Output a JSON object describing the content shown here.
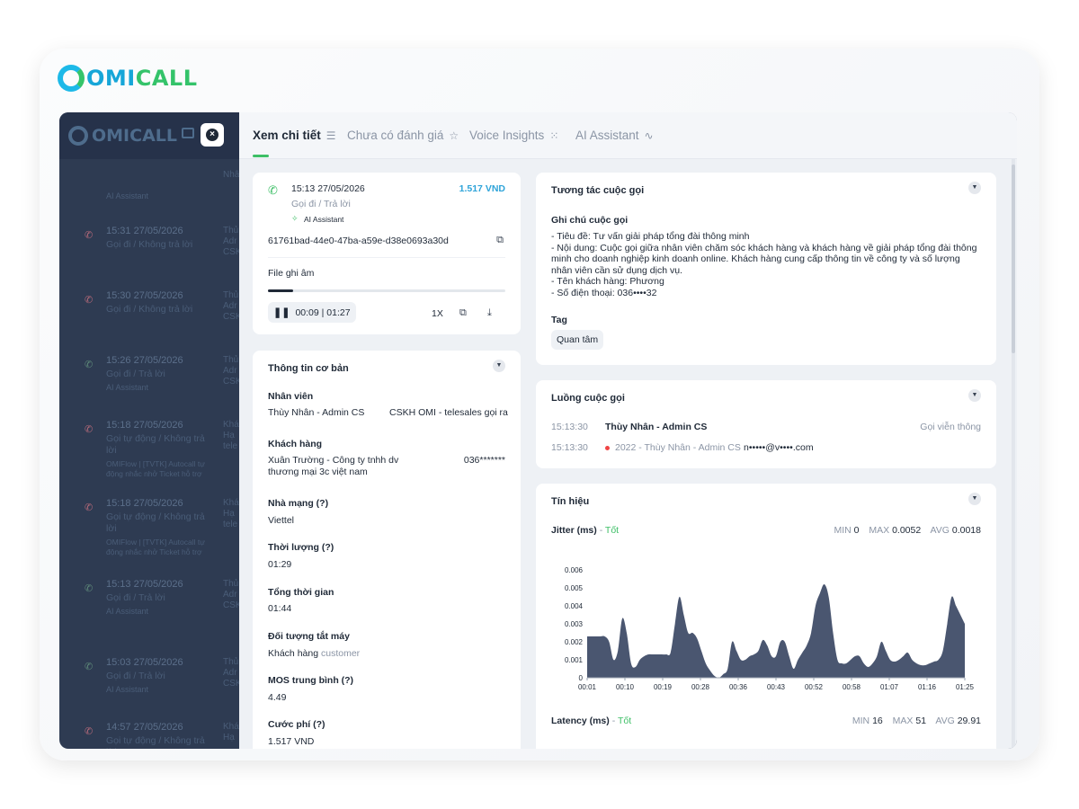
{
  "brand": {
    "part1": "OMI",
    "part2": "CALL"
  },
  "background": {
    "logo": "OMICALL",
    "close_icon": "close-icon",
    "rows": [
      {
        "time": "",
        "status": "",
        "ai": "AI Assistant",
        "col2": "Nhâ"
      },
      {
        "time": "15:31 27/05/2026",
        "status": "Gọi đi / Không trả lời",
        "ai": "",
        "col2": "Thủ\nAdr\nCSK"
      },
      {
        "time": "15:30 27/05/2026",
        "status": "Gọi đi / Không trả lời",
        "ai": "",
        "col2": "Thủ\nAdr\nCSK"
      },
      {
        "time": "15:26 27/05/2026",
        "status": "Gọi đi / Trả lời",
        "ai": "AI Assistant",
        "col2": "Thủ\nAdr\nCSK"
      },
      {
        "time": "15:18 27/05/2026",
        "status": "Gọi tự động / Không trả lời",
        "flow": "OMIFlow | [TVTK] Autocall tự động nhắc nhở Ticket hỗ trợ",
        "col2": "Khá\nHạ\ntele"
      },
      {
        "time": "15:18 27/05/2026",
        "status": "Gọi tự động / Không trả lời",
        "flow": "OMIFlow | [TVTK] Autocall tự động nhắc nhở Ticket hỗ trợ",
        "col2": "Khá\nHạ\ntele"
      },
      {
        "time": "15:13 27/05/2026",
        "status": "Gọi đi / Trả lời",
        "ai": "AI Assistant",
        "col2": "Thủ\nAdr\nCSK"
      },
      {
        "time": "15:03 27/05/2026",
        "status": "Gọi đi / Trả lời",
        "ai": "AI Assistant",
        "col2": "Thủ\nAdr\nCSK"
      },
      {
        "time": "14:57 27/05/2026",
        "status": "Gọi tự động / Không trả lời",
        "ai": "",
        "col2": "Khá\nHạ"
      }
    ]
  },
  "tabs": [
    {
      "label": "Xem chi tiết",
      "icon": "document-icon",
      "active": true
    },
    {
      "label": "Chưa có đánh giá",
      "icon": "star-icon",
      "active": false
    },
    {
      "label": "Voice Insights",
      "icon": "grid-icon",
      "active": false
    },
    {
      "label": "AI Assistant",
      "icon": "waveform-icon",
      "active": false
    }
  ],
  "call": {
    "datetime": "15:13 27/05/2026",
    "direction": "Gọi đi / Trả lời",
    "ai_badge": "AI Assistant",
    "price": "1.517 VND",
    "call_id": "61761bad-44e0-47ba-a59e-d38e0693a30d",
    "recording_label": "File ghi âm",
    "progress_fraction": 0.107,
    "playback_time": "00:09 | 01:27",
    "speed": "1X"
  },
  "basic_info": {
    "title": "Thông tin cơ bản",
    "staff_label": "Nhân viên",
    "staff_name": "Thùy Nhân - Admin CS",
    "staff_group": "CSKH OMI - telesales gọi ra",
    "customer_label": "Khách hàng",
    "customer_name": "Xuân Trường - Công ty tnhh dv thương mại 3c việt nam",
    "customer_phone": "036*******",
    "carrier_label": "Nhà mạng (?)",
    "carrier": "Viettel",
    "duration_label": "Thời lượng (?)",
    "duration": "01:29",
    "total_label": "Tổng thời gian",
    "total": "01:44",
    "hangup_label": "Đối tượng tắt máy",
    "hangup_value": "Khách hàng",
    "hangup_sub": "customer",
    "mos_label": "MOS trung bình (?)",
    "mos": "4.49",
    "fee_label": "Cước phí (?)",
    "fee": "1.517 VND"
  },
  "interaction": {
    "title": "Tương tác cuộc gọi",
    "notes_label": "Ghi chú cuộc gọi",
    "notes": [
      "- Tiêu đề: Tư vấn giải pháp tổng đài thông minh",
      "- Nội dung: Cuộc gọi giữa nhân viên chăm sóc khách hàng và khách hàng về giải pháp tổng đài thông",
      "minh cho doanh nghiệp kinh doanh online. Khách hàng cung cấp thông tin về công ty và số lượng",
      "nhân viên cần sử dụng dịch vụ.",
      "- Tên khách hàng: Phương",
      "- Số điện thoại: 036••••32"
    ],
    "tag_label": "Tag",
    "tag": "Quan tâm"
  },
  "flow": {
    "title": "Luồng cuộc gọi",
    "rows": [
      {
        "time": "15:13:30",
        "agent": "Thùy Nhân - Admin CS",
        "channel": "Gọi viễn thông"
      },
      {
        "time": "15:13:30",
        "detail": "2022 - Thùy Nhân - Admin CS",
        "email": "n•••••@v••••.com"
      }
    ]
  },
  "signal": {
    "title": "Tín hiệu",
    "jitter_label": "Jitter (ms)",
    "jitter_quality": "Tốt",
    "jitter_min_label": "MIN",
    "jitter_min": "0",
    "jitter_max_label": "MAX",
    "jitter_max": "0.0052",
    "jitter_avg_label": "AVG",
    "jitter_avg": "0.0018",
    "latency_label": "Latency (ms)",
    "latency_quality": "Tốt",
    "latency_min_label": "MIN",
    "latency_min": "16",
    "latency_max_label": "MAX",
    "latency_max": "51",
    "latency_avg_label": "AVG",
    "latency_avg": "29.91"
  },
  "chart_data": {
    "type": "area",
    "title": "",
    "xlabel": "",
    "ylabel": "",
    "ylim": [
      0,
      0.006
    ],
    "yticks": [
      "0",
      "0.001",
      "0.002",
      "0.003",
      "0.004",
      "0.005",
      "0.006"
    ],
    "xticks": [
      "00:01",
      "00:10",
      "00:19",
      "00:28",
      "00:36",
      "00:43",
      "00:52",
      "00:58",
      "01:07",
      "01:16",
      "01:25"
    ],
    "x": [
      0,
      1,
      2,
      3,
      4,
      5,
      6,
      7,
      8,
      9,
      10,
      11,
      12,
      13,
      14,
      15,
      16,
      17,
      18,
      19,
      20,
      21,
      22,
      23,
      24,
      25,
      26,
      27,
      28,
      29,
      30,
      31,
      32,
      33,
      34,
      35,
      36,
      37,
      38,
      39,
      40,
      41,
      42,
      43,
      44,
      45,
      46,
      47,
      48,
      49,
      50,
      51,
      52,
      53,
      54,
      55,
      56,
      57,
      58,
      59,
      60,
      61,
      62,
      63,
      64,
      65,
      66,
      67,
      68,
      69,
      70,
      71,
      72,
      73,
      74,
      75,
      76,
      77,
      78,
      79,
      80,
      81,
      82,
      83,
      84,
      85,
      86
    ],
    "values": [
      0.0023,
      0.0023,
      0.0023,
      0.0023,
      0.0023,
      0.002,
      0.001,
      0.0015,
      0.0033,
      0.0025,
      0.0008,
      0.0006,
      0.001,
      0.0012,
      0.0013,
      0.0013,
      0.0013,
      0.0013,
      0.0013,
      0.0014,
      0.003,
      0.0045,
      0.0035,
      0.0025,
      0.0025,
      0.0022,
      0.0015,
      0.0008,
      0.0004,
      0.0001,
      0.0,
      0.0002,
      0.0005,
      0.002,
      0.0015,
      0.001,
      0.001,
      0.0012,
      0.0013,
      0.0015,
      0.0021,
      0.0018,
      0.0012,
      0.0012,
      0.002,
      0.002,
      0.0012,
      0.0005,
      0.001,
      0.0014,
      0.0018,
      0.0025,
      0.004,
      0.0047,
      0.0052,
      0.0045,
      0.0025,
      0.001,
      0.0008,
      0.0008,
      0.001,
      0.0012,
      0.0012,
      0.0008,
      0.0006,
      0.0008,
      0.0012,
      0.002,
      0.0015,
      0.001,
      0.0009,
      0.001,
      0.0012,
      0.0014,
      0.001,
      0.0008,
      0.0007,
      0.0007,
      0.0008,
      0.0009,
      0.001,
      0.0015,
      0.003,
      0.0045,
      0.004,
      0.0035,
      0.003
    ],
    "grid": false,
    "legend": "none",
    "color": "#4a5670"
  },
  "colors": {
    "accent": "#3dbf66",
    "price": "#2fa4d9",
    "chart": "#4a5670",
    "dot": "#ef4444"
  }
}
